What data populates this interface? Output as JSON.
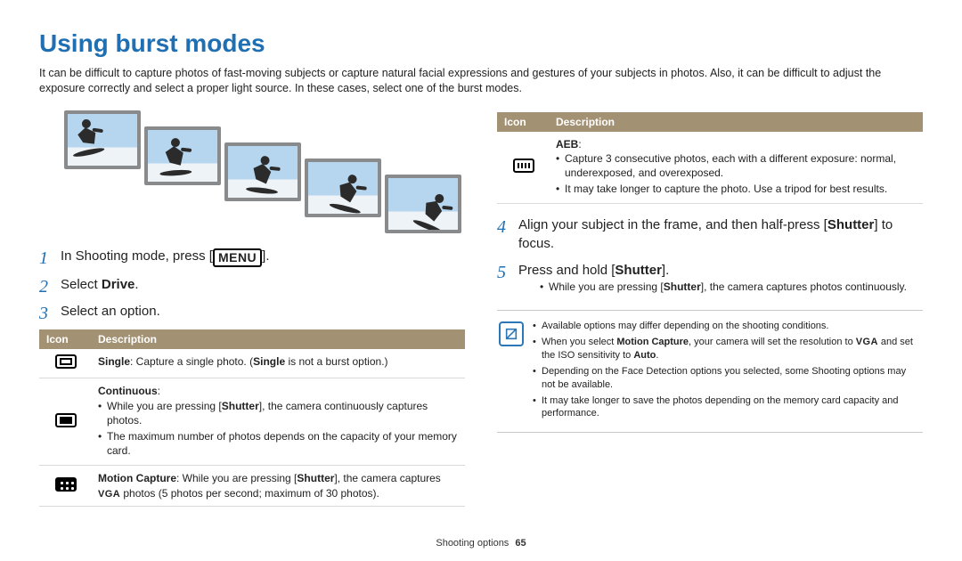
{
  "title": "Using burst modes",
  "intro": "It can be difficult to capture photos of fast-moving subjects or capture natural facial expressions and gestures of your subjects in photos. Also, it can be difficult to adjust the exposure correctly and select a proper light source. In these cases, select one of the burst modes.",
  "steps_left": {
    "s1_a": "In Shooting mode, press [",
    "s1_menu": "MENU",
    "s1_b": "].",
    "s2_a": "Select ",
    "s2_bold": "Drive",
    "s2_b": ".",
    "s3": "Select an option."
  },
  "table_left": {
    "h_icon": "Icon",
    "h_desc": "Description",
    "r1_bold": "Single",
    "r1_a": ": Capture a single photo. (",
    "r1_bold2": "Single",
    "r1_b": " is not a burst option.)",
    "r2_title": "Continuous",
    "r2_title_colon": ":",
    "r2_li1_a": "While you are pressing [",
    "r2_li1_bold": "Shutter",
    "r2_li1_b": "], the camera continuously captures photos.",
    "r2_li2": "The maximum number of photos depends on the capacity of your memory card.",
    "r3_bold": "Motion Capture",
    "r3_a": ": While you are pressing [",
    "r3_bold2": "Shutter",
    "r3_b": "], the camera captures ",
    "r3_vga": "VGA",
    "r3_c": " photos (5 photos per second; maximum of 30 photos)."
  },
  "table_right": {
    "h_icon": "Icon",
    "h_desc": "Description",
    "r1_title": "AEB",
    "r1_title_colon": ":",
    "r1_li1": "Capture 3 consecutive photos, each with a different exposure: normal, underexposed, and overexposed.",
    "r1_li2": "It may take longer to capture the photo. Use a tripod for best results."
  },
  "steps_right": {
    "s4_a": "Align your subject in the frame, and then half-press [",
    "s4_bold": "Shutter",
    "s4_b": "] to focus.",
    "s5_a": "Press and hold [",
    "s5_bold": "Shutter",
    "s5_b": "].",
    "s5_sub_a": "While you are pressing [",
    "s5_sub_bold": "Shutter",
    "s5_sub_b": "], the camera captures photos continuously."
  },
  "note": {
    "li1": "Available options may differ depending on the shooting conditions.",
    "li2_a": "When you select ",
    "li2_bold": "Motion Capture",
    "li2_b": ", your camera will set the resolution to ",
    "li2_vga": "VGA",
    "li2_c": " and set the ISO sensitivity to ",
    "li2_bold2": "Auto",
    "li2_d": ".",
    "li3": "Depending on the Face Detection options you selected, some Shooting options may not be available.",
    "li4": "It may take longer to save the photos depending on the memory card capacity and performance."
  },
  "footer": {
    "section": "Shooting options",
    "page": "65"
  }
}
